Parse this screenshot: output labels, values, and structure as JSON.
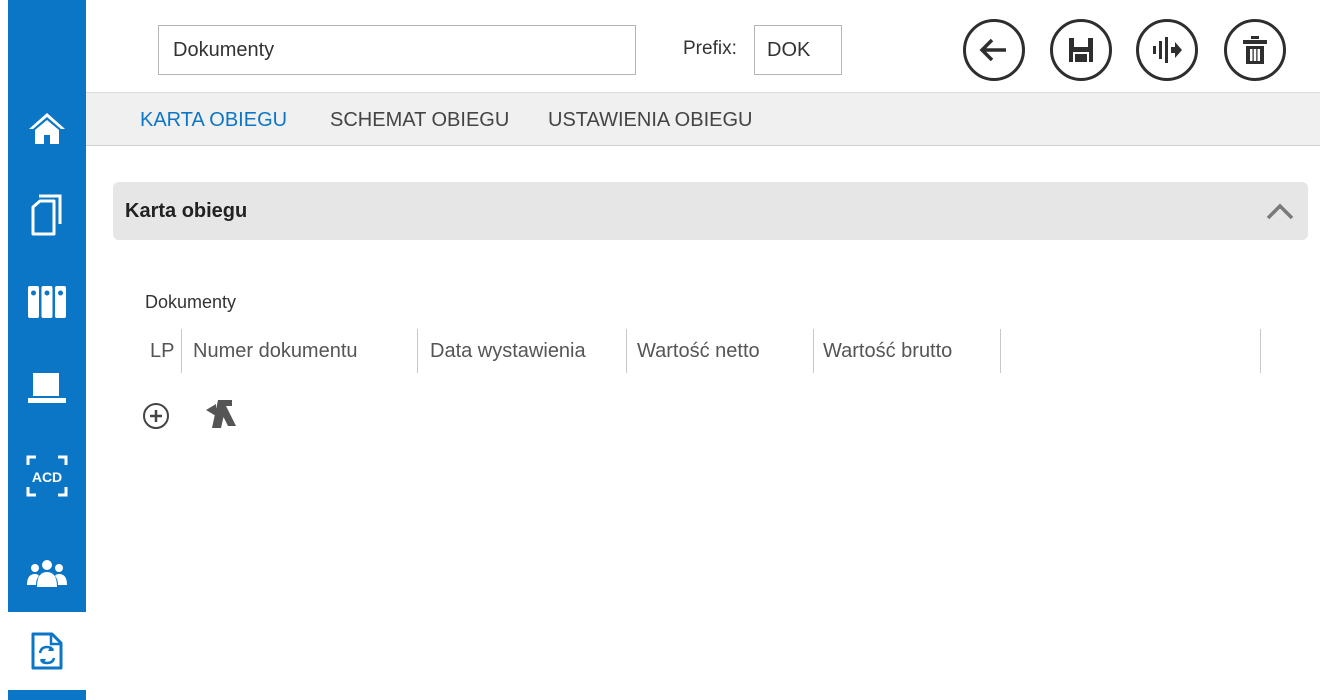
{
  "sidebar": {
    "items": [
      {
        "icon": "home-icon"
      },
      {
        "icon": "documents-icon"
      },
      {
        "icon": "binders-icon"
      },
      {
        "icon": "scanner-icon"
      },
      {
        "icon": "acd-icon",
        "text": "ACD"
      },
      {
        "icon": "contractors-icon"
      },
      {
        "icon": "workflow-document-icon"
      }
    ],
    "colors": {
      "background": "#0c76c6",
      "active_icon": "#0c76c6"
    }
  },
  "header": {
    "name_value": "Dokumenty",
    "prefix_label": "Prefix:",
    "prefix_value": "DOK",
    "buttons": [
      {
        "icon": "back-arrow-icon"
      },
      {
        "icon": "save-icon"
      },
      {
        "icon": "workflow-icon"
      },
      {
        "icon": "trash-icon"
      }
    ]
  },
  "tabs": [
    {
      "label": "KARTA OBIEGU",
      "active": true
    },
    {
      "label": "SCHEMAT OBIEGU",
      "active": false
    },
    {
      "label": "USTAWIENIA OBIEGU",
      "active": false
    }
  ],
  "section": {
    "title": "Karta obiegu",
    "collapse_icon": "chevron-up-icon"
  },
  "grid": {
    "label": "Dokumenty",
    "columns": [
      "LP",
      "Numer dokumentu",
      "Data wystawienia",
      "Wartość netto",
      "Wartość brutto"
    ],
    "actions": [
      {
        "icon": "add-circle-icon"
      },
      {
        "icon": "remove-document-icon"
      }
    ]
  }
}
